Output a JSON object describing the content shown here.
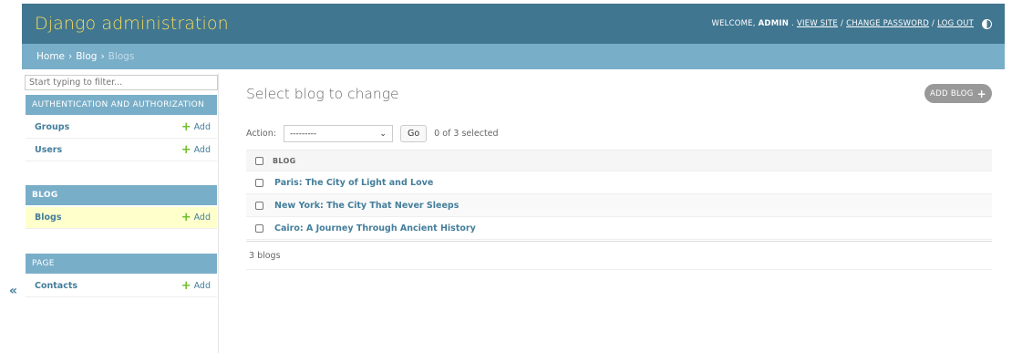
{
  "header": {
    "site_name": "Django administration",
    "welcome": "WELCOME,",
    "username": "ADMIN",
    "view_site": "VIEW SITE",
    "change_password": "CHANGE PASSWORD",
    "log_out": "LOG OUT",
    "separator": "/"
  },
  "breadcrumbs": {
    "home": "Home",
    "app": "Blog",
    "current": "Blogs",
    "sep": "›"
  },
  "sidebar": {
    "filter_placeholder": "Start typing to filter...",
    "modules": [
      {
        "caption": "AUTHENTICATION AND AUTHORIZATION",
        "models": [
          {
            "name": "Groups",
            "add": "Add"
          },
          {
            "name": "Users",
            "add": "Add"
          }
        ]
      },
      {
        "caption": "BLOG",
        "models": [
          {
            "name": "Blogs",
            "add": "Add",
            "selected": true
          }
        ]
      },
      {
        "caption": "PAGE",
        "models": [
          {
            "name": "Contacts",
            "add": "Add"
          }
        ]
      }
    ],
    "collapse_glyph": "«"
  },
  "content": {
    "title": "Select blog to change",
    "add_button": "ADD BLOG",
    "action_label": "Action:",
    "action_select_value": "---------",
    "go_button": "Go",
    "selected_counter": "0 of 3 selected",
    "column_header": "BLOG",
    "rows": [
      "Paris: The City of Light and Love",
      "New York: The City That Never Sleeps",
      "Cairo: A Journey Through Ancient History"
    ],
    "paginator": "3 blogs"
  },
  "colors": {
    "header_bg": "#417690",
    "branding": "#f5dd5d",
    "breadcrumb_bg": "#79aec8",
    "link": "#447e9b",
    "add_green": "#70bf2b",
    "selected_row": "#ffffcc"
  }
}
